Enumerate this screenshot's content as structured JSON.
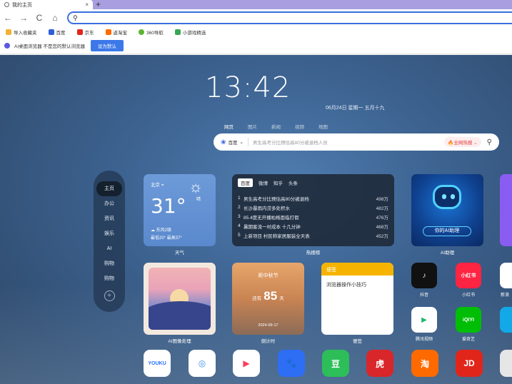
{
  "tab": {
    "title": "我的主页",
    "close": "×",
    "new": "+"
  },
  "nav": {
    "back": "←",
    "forward": "→",
    "reload": "C",
    "home": "⌂"
  },
  "address": {
    "value": ""
  },
  "bookmarks": [
    {
      "label": "导入收藏夹",
      "color": "#f2b233"
    },
    {
      "label": "百度",
      "color": "#2e5fd8"
    },
    {
      "label": "京东",
      "color": "#e1251b"
    },
    {
      "label": "返淘宝",
      "color": "#ff6a00"
    },
    {
      "label": "360导航",
      "color": "#5cb531"
    },
    {
      "label": "小游戏精选",
      "color": "#3aa655"
    }
  ],
  "infobar": {
    "text": "AI桌面浏览器 不是您的默认浏览器",
    "button": "设为默认"
  },
  "clock": {
    "time": "13:42",
    "date": "06月24日 星期一 五月十九"
  },
  "search": {
    "tabs": [
      "网页",
      "图片",
      "新闻",
      "视频",
      "地图"
    ],
    "engine": "百度",
    "placeholder": "男生高考分比预估高80分被退档人员",
    "hot": "全网热搜",
    "search_icon": "search-icon"
  },
  "leftnav": [
    "主页",
    "办公",
    "资讯",
    "娱乐",
    "AI",
    "购物",
    "购物"
  ],
  "weather": {
    "city": "北京",
    "temp": "31°",
    "cond": "晴",
    "wind": "东风2级",
    "range": "最低20° 最高37°",
    "label": "天气"
  },
  "hotlist": {
    "tabs": [
      "百度",
      "微博",
      "知乎",
      "头条"
    ],
    "items": [
      {
        "rank": "1",
        "title": "男生高考分比预估高80分被退档",
        "num": "498万"
      },
      {
        "rank": "2",
        "title": "长沙暴雨内涝多处积水",
        "num": "482万"
      },
      {
        "rank": "3",
        "title": "85.4度无开播柏格面临打假",
        "num": "476万"
      },
      {
        "rank": "4",
        "title": "暑期客流一村成本 十几分钟",
        "num": "468万"
      },
      {
        "rank": "5",
        "title": "上新项目 村民称家居服装全天表",
        "num": "452万"
      }
    ],
    "label": "热搜榜"
  },
  "ai_card": {
    "pill": "你的AI助理",
    "label": "AI助理"
  },
  "ai_image": {
    "label": "AI图像处理"
  },
  "countdown": {
    "event": "距中秋节",
    "prefix": "还有",
    "days": "85",
    "unit": "天",
    "date": "2024-09-17",
    "label": "倒计时"
  },
  "memo": {
    "head": "便签",
    "text": "浏览器操作小技巧",
    "label": "便签"
  },
  "apps": [
    {
      "label": "抖音",
      "text": "♪",
      "color": "#111111"
    },
    {
      "label": "小红书",
      "text": "小红书",
      "color": "#ff2442"
    },
    {
      "label": "新浪",
      "text": "",
      "color": "#ffffff"
    },
    {
      "label": "腾讯视频",
      "text": "▶",
      "color": "#ffffff"
    },
    {
      "label": "爱奇艺",
      "text": "iQIYI",
      "color": "#00be06"
    },
    {
      "label": "",
      "text": "",
      "color": "#13a8e8"
    }
  ],
  "dock": [
    {
      "text": "YOUKU",
      "color": "#ffffff",
      "fg": "#2570ff"
    },
    {
      "text": "◎",
      "color": "#ffffff",
      "fg": "#3a8ee6"
    },
    {
      "text": "▶",
      "color": "#ffffff",
      "fg": "#ff3b5c"
    },
    {
      "text": "🐾",
      "color": "#2e6ef5",
      "fg": "#ffffff"
    },
    {
      "text": "豆",
      "color": "#2dbe5a",
      "fg": "#ffffff"
    },
    {
      "text": "虎",
      "color": "#d9262a",
      "fg": "#ffffff"
    },
    {
      "text": "淘",
      "color": "#ff6a00",
      "fg": "#ffffff"
    },
    {
      "text": "JD",
      "color": "#e1251b",
      "fg": "#ffffff"
    }
  ]
}
